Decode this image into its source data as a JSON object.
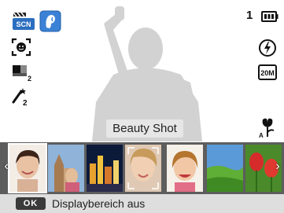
{
  "top_left": {
    "scene_badge": "SCN"
  },
  "top_right": {
    "shot_count": "1",
    "resolution": "20M"
  },
  "mode": {
    "label": "Beauty Shot"
  },
  "filmstrip": {
    "thumbnails": [
      {
        "name": "beauty-shot",
        "selected": true
      },
      {
        "name": "frame-shot",
        "selected": false
      },
      {
        "name": "night-scene",
        "selected": false
      },
      {
        "name": "portrait-frame",
        "selected": false
      },
      {
        "name": "children",
        "selected": false
      },
      {
        "name": "landscape",
        "selected": false
      },
      {
        "name": "flowers",
        "selected": false
      }
    ]
  },
  "bottom_bar": {
    "ok_label": "OK",
    "hint": "Displaybereich aus"
  },
  "colors": {
    "filmstrip_bg": "#5d5d5d",
    "bottom_bar_bg": "#dedede",
    "label_bg": "#e6e6e6",
    "silhouette": "#d2d2d2"
  }
}
